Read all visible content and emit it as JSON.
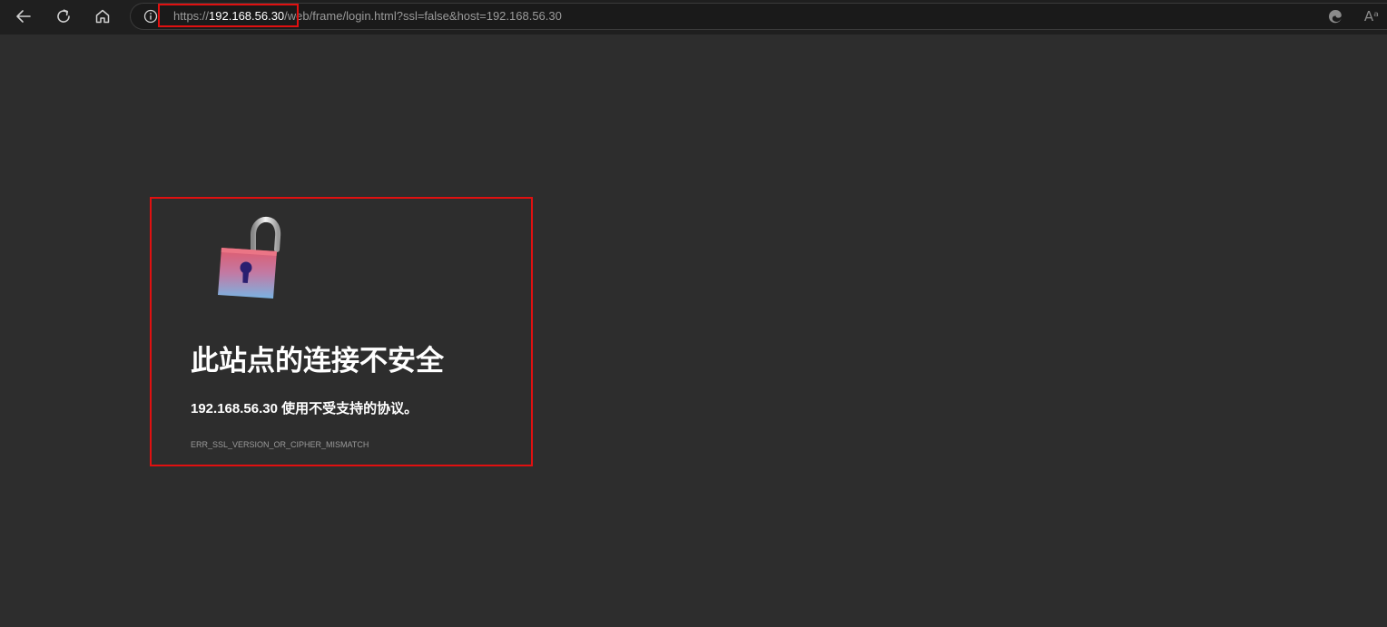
{
  "toolbar": {
    "back_icon": "arrow-left-icon",
    "refresh_icon": "refresh-icon",
    "home_icon": "home-icon",
    "info_icon": "info-icon",
    "edge_icon": "edge-logo-icon",
    "read_aloud_icon": "read-aloud-icon",
    "read_aloud_glyph": "Aᵃ"
  },
  "address": {
    "scheme": "https://",
    "host": "192.168.56.30",
    "path": "/web/frame/login.html?ssl=false&host=192.168.56.30"
  },
  "error": {
    "icon": "open-padlock-icon",
    "headline": "此站点的连接不安全",
    "message": "192.168.56.30 使用不受支持的协议。",
    "code": "ERR_SSL_VERSION_OR_CIPHER_MISMATCH"
  },
  "colors": {
    "page_background": "#2d2d2d",
    "toolbar_background": "#1f1f1f",
    "highlight_border": "#e01010",
    "text_primary": "#ffffff",
    "text_secondary": "#9a9a9a"
  }
}
